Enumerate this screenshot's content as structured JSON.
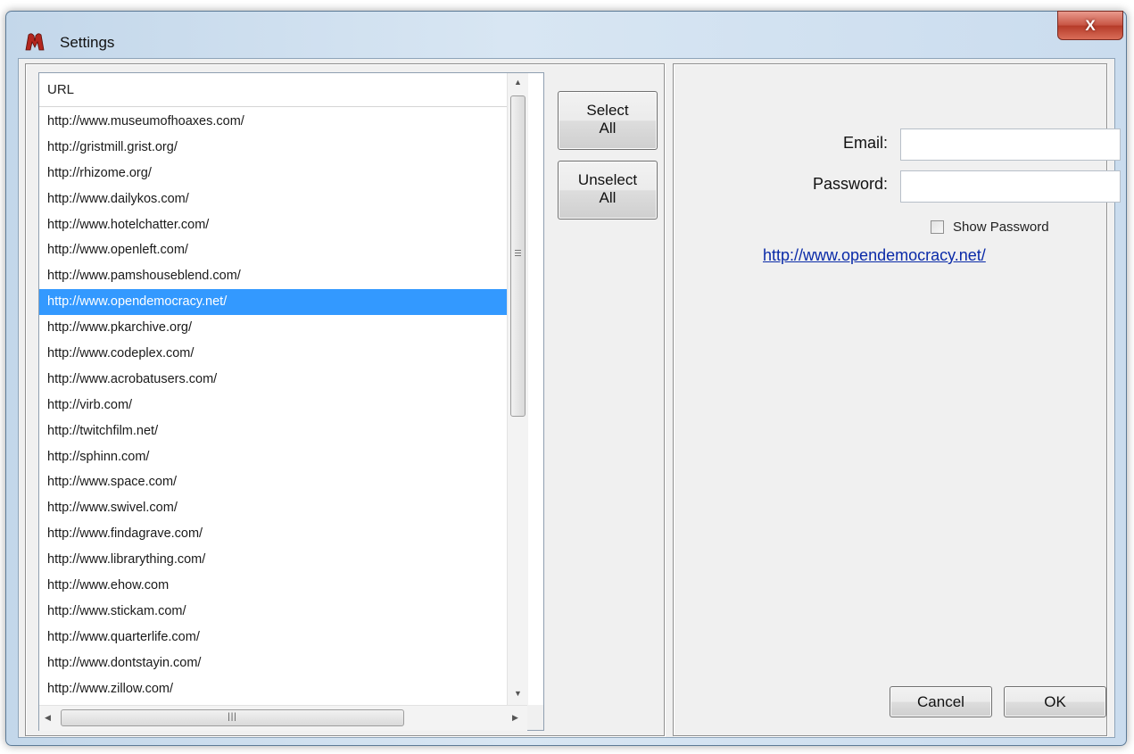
{
  "window": {
    "title": "Settings",
    "close_label": "X"
  },
  "url_list": {
    "header": "URL",
    "selected_index": 7,
    "items": [
      "http://www.museumofhoaxes.com/",
      "http://gristmill.grist.org/",
      "http://rhizome.org/",
      "http://www.dailykos.com/",
      "http://www.hotelchatter.com/",
      "http://www.openleft.com/",
      "http://www.pamshouseblend.com/",
      "http://www.opendemocracy.net/",
      "http://www.pkarchive.org/",
      "http://www.codeplex.com/",
      "http://www.acrobatusers.com/",
      "http://virb.com/",
      "http://twitchfilm.net/",
      "http://sphinn.com/",
      "http://www.space.com/",
      "http://www.swivel.com/",
      "http://www.findagrave.com/",
      "http://www.librarything.com/",
      "http://www.ehow.com",
      "http://www.stickam.com/",
      "http://www.quarterlife.com/",
      "http://www.dontstayin.com/",
      "http://www.zillow.com/"
    ]
  },
  "buttons": {
    "select_all_line1": "Select",
    "select_all_line2": "All",
    "unselect_all_line1": "Unselect",
    "unselect_all_line2": "All",
    "cancel": "Cancel",
    "ok": "OK"
  },
  "form": {
    "email_label": "Email:",
    "email_value": "",
    "password_label": "Password:",
    "password_value": "",
    "show_password_label": "Show Password",
    "show_password_checked": false,
    "selected_url_link": "http://www.opendemocracy.net/"
  },
  "colors": {
    "selection": "#3399ff",
    "link": "#0a2aa8"
  },
  "icons": {
    "app": "app-logo-icon",
    "close": "close-icon",
    "scroll_up": "scroll-up-arrow-icon",
    "scroll_down": "scroll-down-arrow-icon",
    "scroll_left": "scroll-left-arrow-icon",
    "scroll_right": "scroll-right-arrow-icon",
    "scroll_grip": "scroll-grip-icon"
  }
}
